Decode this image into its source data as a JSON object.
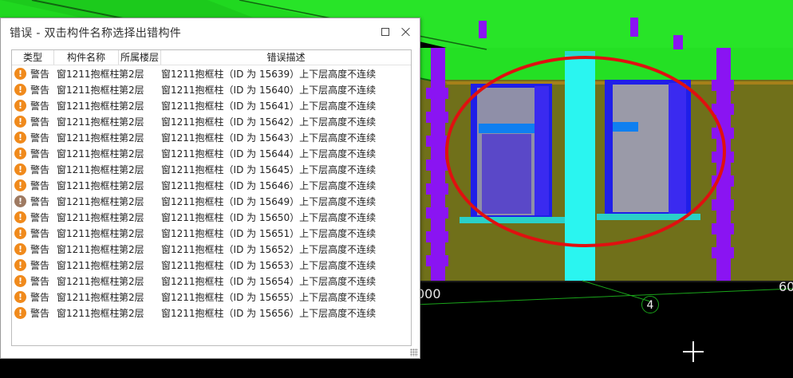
{
  "dialog": {
    "title": "错误 - 双击构件名称选择出错构件",
    "columns": [
      "类型",
      "构件名称",
      "所属楼层",
      "错误描述"
    ],
    "rows": [
      {
        "type": "警告",
        "name": "窗1211抱框柱",
        "floor": "第2层",
        "desc": "窗1211抱框柱（ID 为 15639）上下层高度不连续"
      },
      {
        "type": "警告",
        "name": "窗1211抱框柱",
        "floor": "第2层",
        "desc": "窗1211抱框柱（ID 为 15640）上下层高度不连续"
      },
      {
        "type": "警告",
        "name": "窗1211抱框柱",
        "floor": "第2层",
        "desc": "窗1211抱框柱（ID 为 15641）上下层高度不连续"
      },
      {
        "type": "警告",
        "name": "窗1211抱框柱",
        "floor": "第2层",
        "desc": "窗1211抱框柱（ID 为 15642）上下层高度不连续"
      },
      {
        "type": "警告",
        "name": "窗1211抱框柱",
        "floor": "第2层",
        "desc": "窗1211抱框柱（ID 为 15643）上下层高度不连续"
      },
      {
        "type": "警告",
        "name": "窗1211抱框柱",
        "floor": "第2层",
        "desc": "窗1211抱框柱（ID 为 15644）上下层高度不连续"
      },
      {
        "type": "警告",
        "name": "窗1211抱框柱",
        "floor": "第2层",
        "desc": "窗1211抱框柱（ID 为 15645）上下层高度不连续"
      },
      {
        "type": "警告",
        "name": "窗1211抱框柱",
        "floor": "第2层",
        "desc": "窗1211抱框柱（ID 为 15646）上下层高度不连续"
      },
      {
        "type": "警告",
        "name": "窗1211抱框柱",
        "floor": "第2层",
        "desc": "窗1211抱框柱（ID 为 15649）上下层高度不连续",
        "muted": true
      },
      {
        "type": "警告",
        "name": "窗1211抱框柱",
        "floor": "第2层",
        "desc": "窗1211抱框柱（ID 为 15650）上下层高度不连续"
      },
      {
        "type": "警告",
        "name": "窗1211抱框柱",
        "floor": "第2层",
        "desc": "窗1211抱框柱（ID 为 15651）上下层高度不连续"
      },
      {
        "type": "警告",
        "name": "窗1211抱框柱",
        "floor": "第2层",
        "desc": "窗1211抱框柱（ID 为 15652）上下层高度不连续"
      },
      {
        "type": "警告",
        "name": "窗1211抱框柱",
        "floor": "第2层",
        "desc": "窗1211抱框柱（ID 为 15653）上下层高度不连续"
      },
      {
        "type": "警告",
        "name": "窗1211抱框柱",
        "floor": "第2层",
        "desc": "窗1211抱框柱（ID 为 15654）上下层高度不连续"
      },
      {
        "type": "警告",
        "name": "窗1211抱框柱",
        "floor": "第2层",
        "desc": "窗1211抱框柱（ID 为 15655）上下层高度不连续"
      },
      {
        "type": "警告",
        "name": "窗1211抱框柱",
        "floor": "第2层",
        "desc": "窗1211抱框柱（ID 为 15656）上下层高度不连续"
      }
    ]
  },
  "viewport": {
    "dimension_left": "000",
    "dimension_right": "60",
    "axis_bubble": "4",
    "colors": {
      "beam": "#22e622",
      "wall": "#70701a",
      "column_cyan": "#2af5f0",
      "column_purple": "#8a14f2",
      "highlight_ellipse": "#e01010"
    }
  },
  "icons": {
    "warning": "exclamation-circle-icon",
    "maximize": "maximize-icon",
    "close": "close-icon",
    "crosshair": "crosshair-cursor-icon",
    "resize": "resize-grip-icon"
  }
}
